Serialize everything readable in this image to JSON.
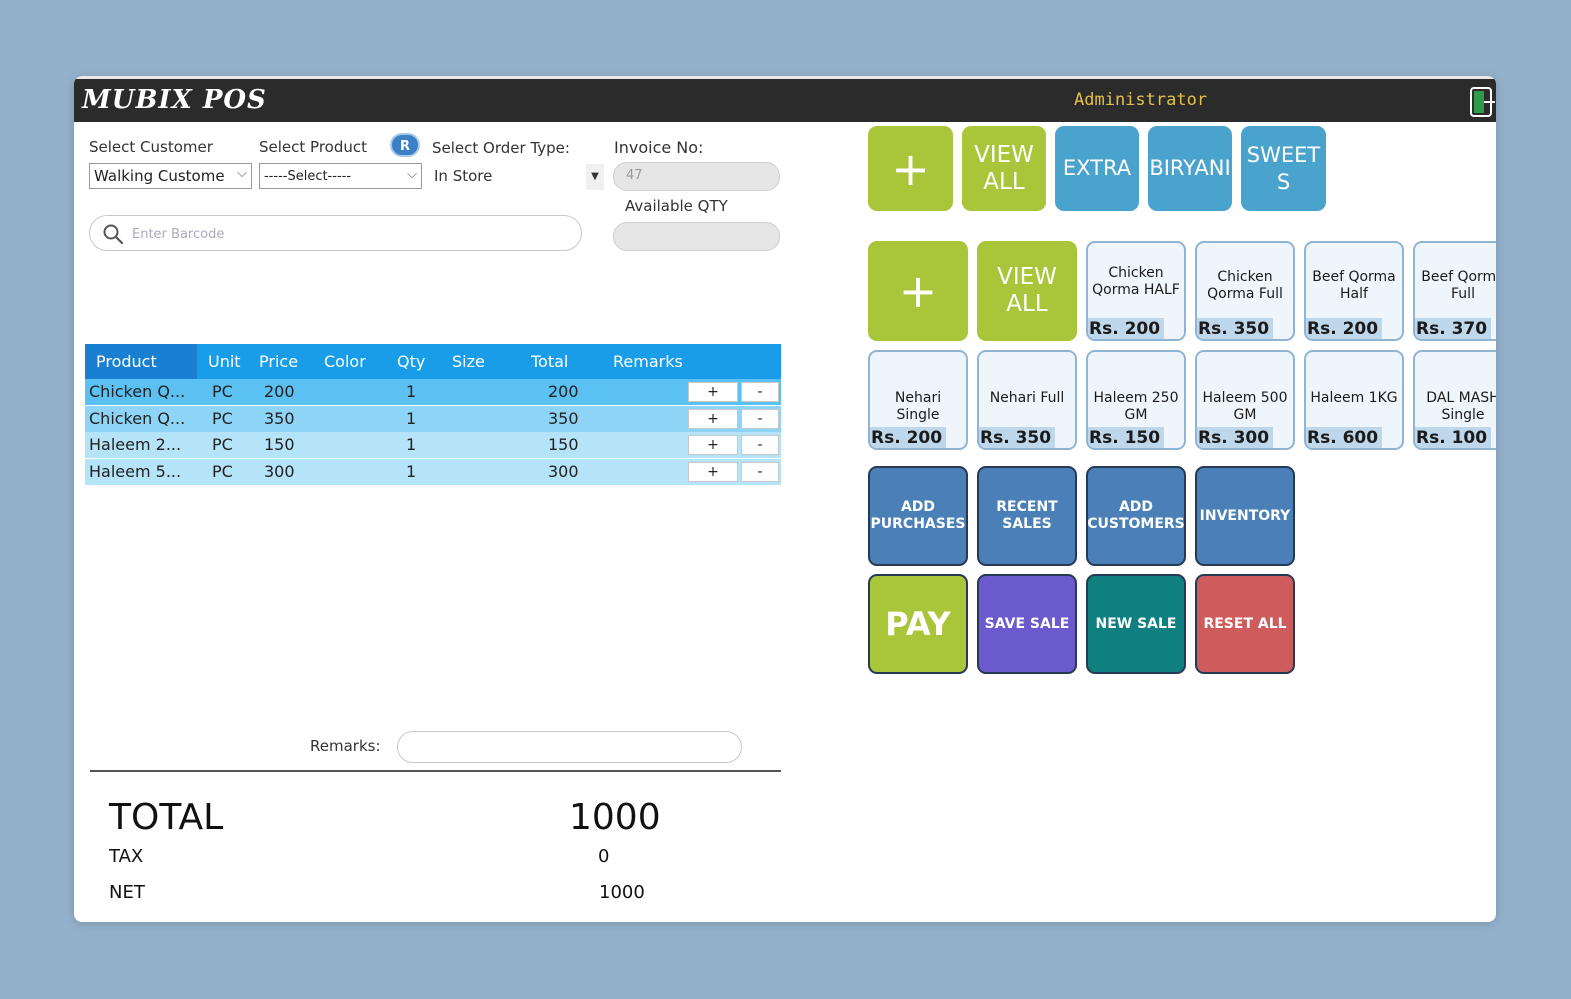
{
  "header": {
    "app_title": "MUBIX POS",
    "user": "Administrator"
  },
  "form": {
    "customer_label": "Select Customer",
    "customer_value": "Walking Custome",
    "product_label": "Select Product",
    "product_value": "-----Select-----",
    "r_badge": "R",
    "order_type_label": "Select Order Type:",
    "order_type_value": "In Store",
    "invoice_label": "Invoice No:",
    "invoice_value": "47",
    "available_qty_label": "Available QTY",
    "available_qty_value": "",
    "barcode_placeholder": "Enter Barcode"
  },
  "grid": {
    "columns": [
      "Product",
      "Unit",
      "Price",
      "Color",
      "Qty",
      "Size",
      "Total",
      "Remarks"
    ],
    "rows": [
      {
        "product": "Chicken Q...",
        "unit": "PC",
        "price": "200",
        "color": "",
        "qty": "1",
        "size": "",
        "total": "200",
        "remarks": "",
        "bg": "#5ac1f2"
      },
      {
        "product": "Chicken Q...",
        "unit": "PC",
        "price": "350",
        "color": "",
        "qty": "1",
        "size": "",
        "total": "350",
        "remarks": "",
        "bg": "#8dd4f6"
      },
      {
        "product": "Haleem 2...",
        "unit": "PC",
        "price": "150",
        "color": "",
        "qty": "1",
        "size": "",
        "total": "150",
        "remarks": "",
        "bg": "#b5e3f8"
      },
      {
        "product": "Haleem 5...",
        "unit": "PC",
        "price": "300",
        "color": "",
        "qty": "1",
        "size": "",
        "total": "300",
        "remarks": "",
        "bg": "#b5e3f8"
      }
    ],
    "plus_label": "+",
    "minus_label": "-"
  },
  "remarks": {
    "label": "Remarks:",
    "value": ""
  },
  "totals": {
    "total_label": "TOTAL",
    "total_value": "1000",
    "tax_label": "TAX",
    "tax_value": "0",
    "net_label": "NET",
    "net_value": "1000"
  },
  "categories": {
    "add_label": "+",
    "view_all_label": "VIEW\nALL",
    "items": [
      "EXTRA",
      "BIRYANI",
      "SWEET\nS"
    ]
  },
  "products": {
    "add_label": "+",
    "view_all_label": "VIEW\nALL",
    "items": [
      {
        "name": "Chicken Qorma HALF",
        "price": "Rs. 200"
      },
      {
        "name": "Chicken Qorma Full",
        "price": "Rs. 350"
      },
      {
        "name": "Beef Qorma Half",
        "price": "Rs. 200"
      },
      {
        "name": "Beef Qorma Full",
        "price": "Rs. 370"
      },
      {
        "name": "Nehari Single",
        "price": "Rs. 200"
      },
      {
        "name": "Nehari Full",
        "price": "Rs. 350"
      },
      {
        "name": "Haleem 250 GM",
        "price": "Rs. 150"
      },
      {
        "name": "Haleem 500 GM",
        "price": "Rs. 300"
      },
      {
        "name": "Haleem 1KG",
        "price": "Rs. 600"
      },
      {
        "name": "DAL MASH Single",
        "price": "Rs. 100"
      }
    ]
  },
  "actions": {
    "add_purchases": "ADD PURCHASES",
    "recent_sales": "RECENT SALES",
    "add_customers": "ADD CUSTOMERS",
    "inventory": "INVENTORY",
    "pay": "PAY",
    "save_sale": "SAVE SALE",
    "new_sale": "NEW SALE",
    "reset_all": "RESET ALL"
  },
  "colors": {
    "titlebar": "#2b2b2b",
    "accent_blue": "#1a9de8",
    "green": "#a9c53a",
    "purple": "#6a5acd",
    "teal": "#0f7f7f",
    "red": "#cf5c5c",
    "action_blue": "#4a80b7"
  }
}
